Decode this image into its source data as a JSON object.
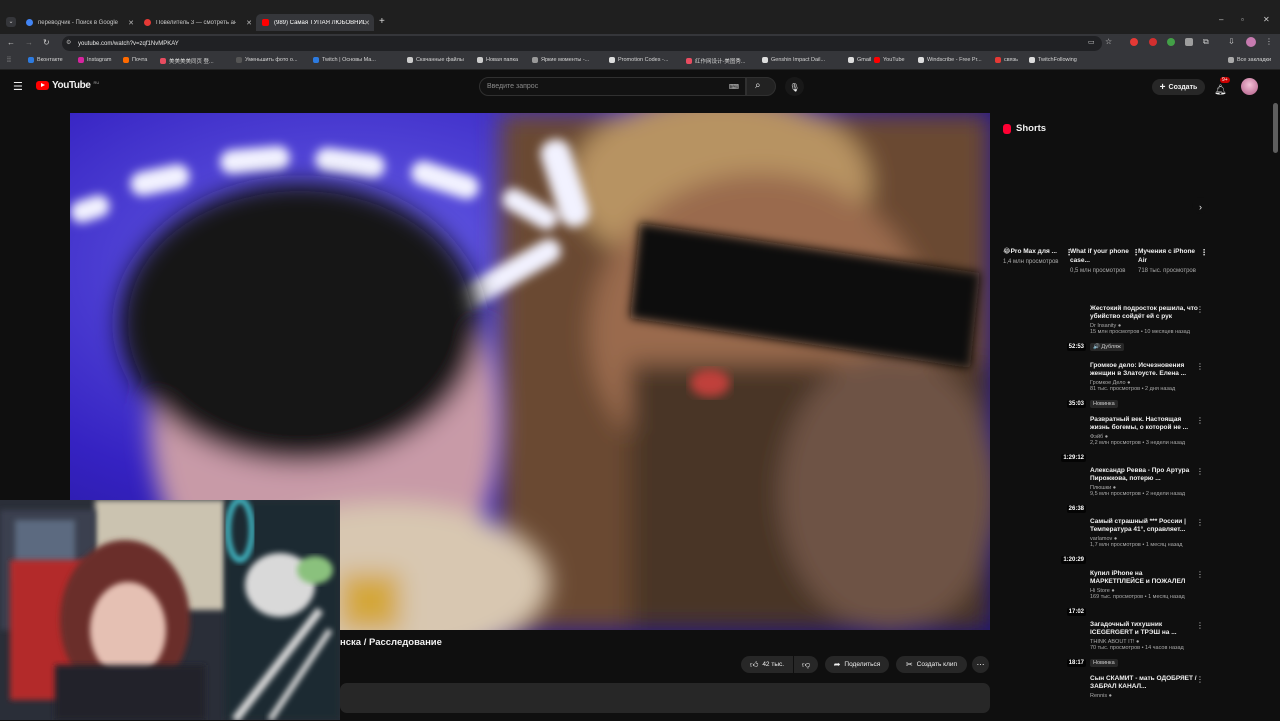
{
  "browser": {
    "tabs": [
      {
        "title": "переводчик - Поиск в Google",
        "color": "#4285f4"
      },
      {
        "title": "Повелитель 3 — смотреть аниме",
        "color": "#e53935"
      },
      {
        "title": "(989) Самая ТУПАЯ ЛЮБОВНИЦА",
        "color": "#ff0000"
      }
    ],
    "url": "youtube.com/watch?v=zqf1NvMPKAY",
    "bookmarks": [
      {
        "label": "Вконтакте",
        "color": "#2d7be0"
      },
      {
        "label": "Instagram",
        "color": "#d6249f"
      },
      {
        "label": "Почта",
        "color": "#ff6a00"
      },
      {
        "label": "美美美美同页 登...",
        "color": "#e84c60"
      },
      {
        "label": "Уменьшить фото о...",
        "color": "#555555"
      },
      {
        "label": "Twitch | Основы Ма...",
        "color": "#2d7be0"
      },
      {
        "label": "Скачанные файлы",
        "color": "#cccccc"
      },
      {
        "label": "Новая папка",
        "color": "#cccccc"
      },
      {
        "label": "Яркие моменты -...",
        "color": "#999999"
      },
      {
        "label": "Promotion Codes -...",
        "color": "#dddddd"
      },
      {
        "label": "红作网设计-美图秀...",
        "color": "#e84c60"
      },
      {
        "label": "Genshin Impact Dail...",
        "color": "#dddddd"
      },
      {
        "label": "Gmail",
        "color": "#dddddd"
      },
      {
        "label": "YouTube",
        "color": "#ff0000"
      },
      {
        "label": "Windscribe - Free Pr...",
        "color": "#dddddd"
      },
      {
        "label": "связь",
        "color": "#e53935"
      },
      {
        "label": "TwitchFollowing",
        "color": "#dddddd"
      }
    ],
    "all_bookmarks": "Все закладки"
  },
  "youtube": {
    "logo": "YouTube",
    "logo_region": "RU",
    "search_placeholder": "Введите запрос",
    "create_label": "Создать",
    "notif_count": "9+"
  },
  "video": {
    "title": "нска / Расследование",
    "likes": "42 тыс.",
    "share_label": "Поделиться",
    "clip_label": "Создать клип"
  },
  "shorts": {
    "heading": "Shorts",
    "items": [
      {
        "title": "😂Pro Max для ...",
        "views": "1,4 млн просмотров"
      },
      {
        "title": "What if your phone case...",
        "views": "0,5 млн просмотров"
      },
      {
        "title": "Мучения с iPhone Air",
        "views": "718 тыс. просмотров"
      }
    ]
  },
  "recommendations": [
    {
      "title": "Жестокий подросток решила, что убийство сойдёт ей с рук",
      "channel": "Dr Insanity",
      "meta": "15 млн просмотров • 10 месяцев назад",
      "badge": "🔊 Дубляж",
      "duration": "52:53"
    },
    {
      "title": "Громкое дело: Исчезновения женщин в Златоусте. Елена ...",
      "channel": "Громкое Дело",
      "meta": "81 тыс. просмотров • 2 дня назад",
      "badge": "Новинка",
      "duration": "35:03"
    },
    {
      "title": "Развратный век. Настоящая жизнь богемы, о которой не ...",
      "channel": "Фэйб",
      "meta": "2,2 млн просмотров • 3 недели назад",
      "badge": "",
      "duration": "1:29:12"
    },
    {
      "title": "Александр Ревва - Про Артура Пирожкова, потерю ...",
      "channel": "Плюшки",
      "meta": "9,5 млн просмотров • 2 недели назад",
      "badge": "",
      "duration": "26:38"
    },
    {
      "title": "Самый страшный *** России | Температура 41°, справляет...",
      "channel": "varlamov",
      "meta": "1,7 млн просмотров • 1 месяц назад",
      "badge": "",
      "duration": "1:20:29"
    },
    {
      "title": "Купил iPhone на МАРКЕТПЛЕЙСЕ и ПОЖАЛЕЛ",
      "channel": "Hi Store",
      "meta": "169 тыс. просмотров • 1 месяц назад",
      "badge": "",
      "duration": "17:02"
    },
    {
      "title": "Загадочный тихушник ICEGERGERT и ТРЭШ на ...",
      "channel": "THINK ABOUT IT!",
      "meta": "70 тыс. просмотров • 14 часов назад",
      "badge": "Новинка",
      "duration": "18:17"
    },
    {
      "title": "Сын СКАМИТ - мать ОДОБРЯЕТ / ЗАБРАЛ КАНАЛ...",
      "channel": "Rennis",
      "meta": "",
      "badge": "",
      "duration": ""
    }
  ]
}
